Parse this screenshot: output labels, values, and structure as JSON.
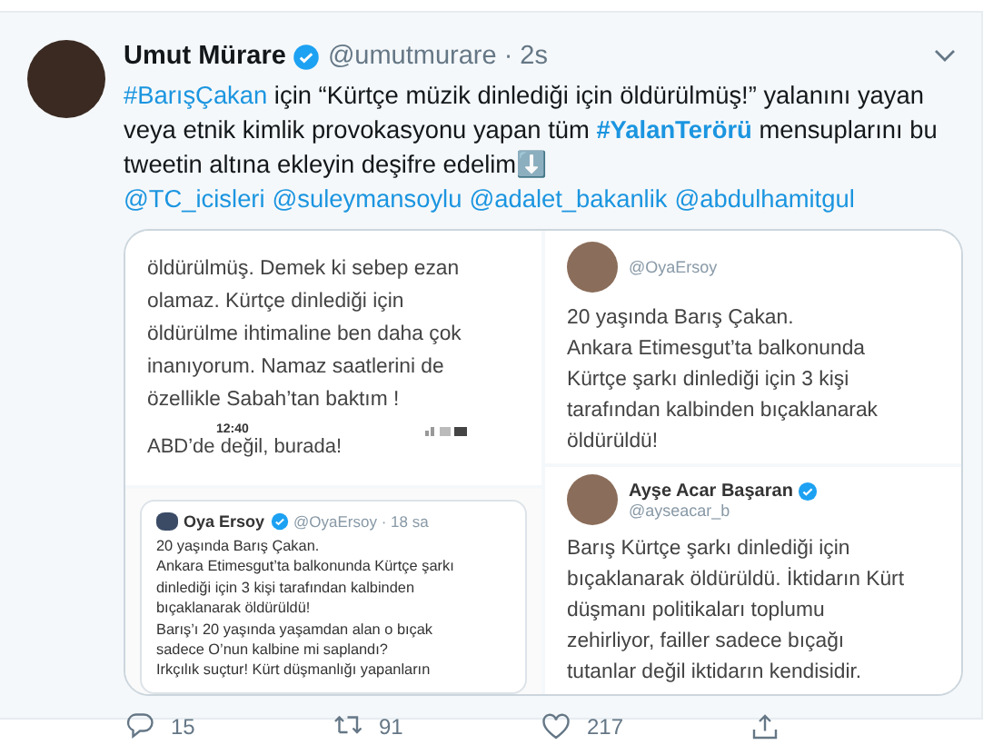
{
  "tweet": {
    "author": {
      "name": "Umut Mürare",
      "verified": true,
      "handle": "@umutmurare",
      "time": "· 2s"
    },
    "body": [
      {
        "kind": "hashtag",
        "text": "#BarışÇakan"
      },
      {
        "kind": "plain",
        "text": " için “Kürtçe müzik dinlediği için öldürülmüş!” yalanını yayan veya etnik kimlik provokasyonu yapan tüm "
      },
      {
        "kind": "strong-hashtag",
        "text": "#YalanTerörü"
      },
      {
        "kind": "plain",
        "text": " mensuplarını bu tweetin altına ekleyin deşifre edelim"
      },
      {
        "kind": "emoji",
        "text": "⬇️"
      }
    ],
    "mentions": [
      "@TC_icisleri",
      "@suleymansoylu",
      "@adalet_bakanlik",
      "@abdulhamitgul"
    ],
    "media": [
      {
        "kind": "note",
        "lines": [
          "öldürülmüş. Demek ki sebep ezan",
          "olamaz. Kürtçe dinlediği için",
          "öldürülme ihtimaline ben daha çok",
          "inanıyorum. Namaz saatlerini de",
          "özellikle Sabah’tan baktım !"
        ],
        "clock": "12:40",
        "footer": "ABD’de değil, burada!"
      },
      {
        "kind": "tweet",
        "handle": "@OyaErsoy",
        "lines": [
          "20 yaşında Barış Çakan.",
          "Ankara Etimesgut’ta balkonunda",
          "Kürtçe şarkı dinlediği için 3 kişi",
          "tarafından kalbinden bıçaklanarak",
          "öldürüldü!"
        ]
      },
      {
        "kind": "quote",
        "name": "Oya Ersoy",
        "verified": true,
        "handle": "@OyaErsoy · 18 sa",
        "lines": [
          "20 yaşında Barış Çakan.",
          "Ankara Etimesgut’ta balkonunda Kürtçe şarkı",
          "dinlediği için 3 kişi tarafından kalbinden",
          "bıçaklanarak öldürüldü!",
          "Barış’ı 20 yaşında yaşamdan alan o bıçak",
          "sadece O’nun kalbine mi saplandı?",
          "Irkçılık suçtur! Kürt düşmanlığı yapanların"
        ]
      },
      {
        "kind": "tweet",
        "name": "Ayşe Acar Başaran",
        "verified": true,
        "handle": "@ayseacar_b",
        "lines": [
          "Barış Kürtçe şarkı dinlediği için",
          "bıçaklanarak öldürüldü. İktidarın Kürt",
          "düşmanı politikaları toplumu",
          "zehirliyor, failler sadece bıçağı",
          "tutanlar değil iktidarın kendisidir."
        ]
      }
    ],
    "actions": [
      {
        "kind": "reply",
        "count": "15"
      },
      {
        "kind": "retweet",
        "count": "91"
      },
      {
        "kind": "like",
        "count": "217"
      },
      {
        "kind": "share"
      }
    ]
  }
}
